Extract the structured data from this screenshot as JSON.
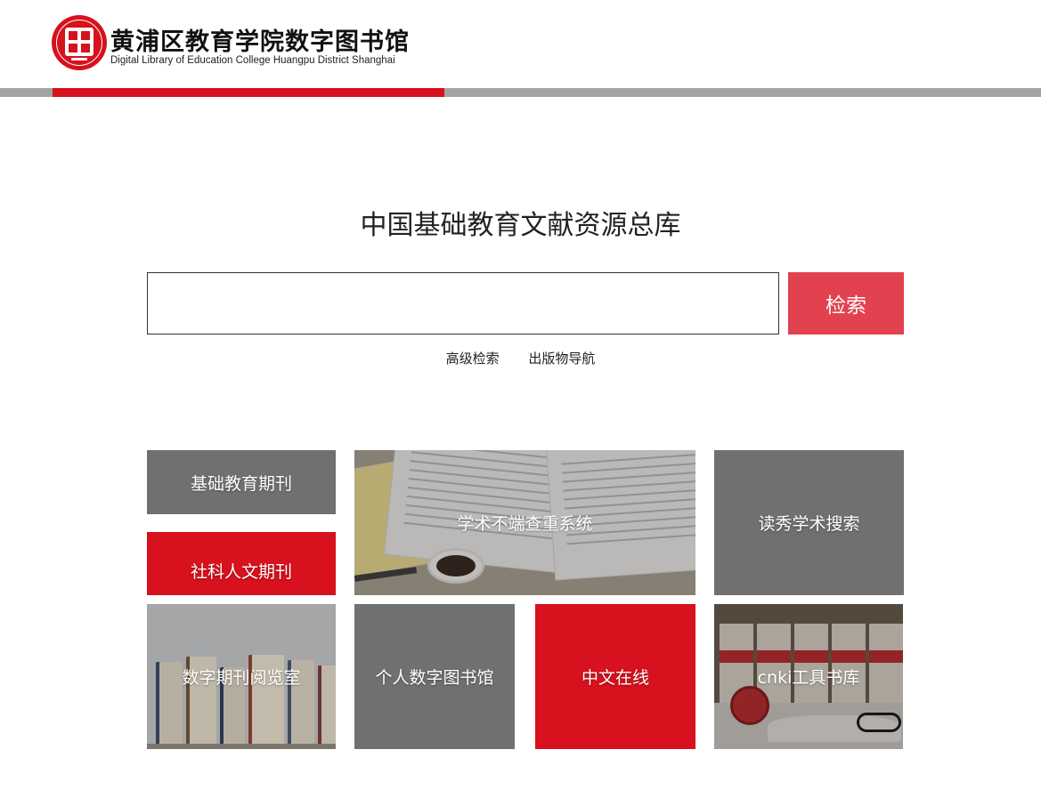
{
  "header": {
    "title": "黄浦区教育学院数字图书馆",
    "subtitle": "Digital Library of Education College Huangpu District Shanghai",
    "logo_icon": "library-seal-icon",
    "brand_color": "#d7111d",
    "bar_color": "#a3a3a3"
  },
  "search": {
    "title": "中国基础教育文献资源总库",
    "input_value": "",
    "button_label": "检索",
    "button_color": "#e24150",
    "links": [
      "高级检索",
      "出版物导航"
    ]
  },
  "tiles": [
    {
      "label": "基础教育期刊",
      "style": "gray"
    },
    {
      "label": "社科人文期刊",
      "style": "red"
    },
    {
      "label": "学术不端查重系统",
      "style": "photo-papers"
    },
    {
      "label": "读秀学术搜索",
      "style": "gray"
    },
    {
      "label": "数字期刊阅览室",
      "style": "photo-books"
    },
    {
      "label": "个人数字图书馆",
      "style": "gray"
    },
    {
      "label": "中文在线",
      "style": "red"
    },
    {
      "label": "cnki工具书库",
      "style": "photo-reference-books"
    }
  ]
}
